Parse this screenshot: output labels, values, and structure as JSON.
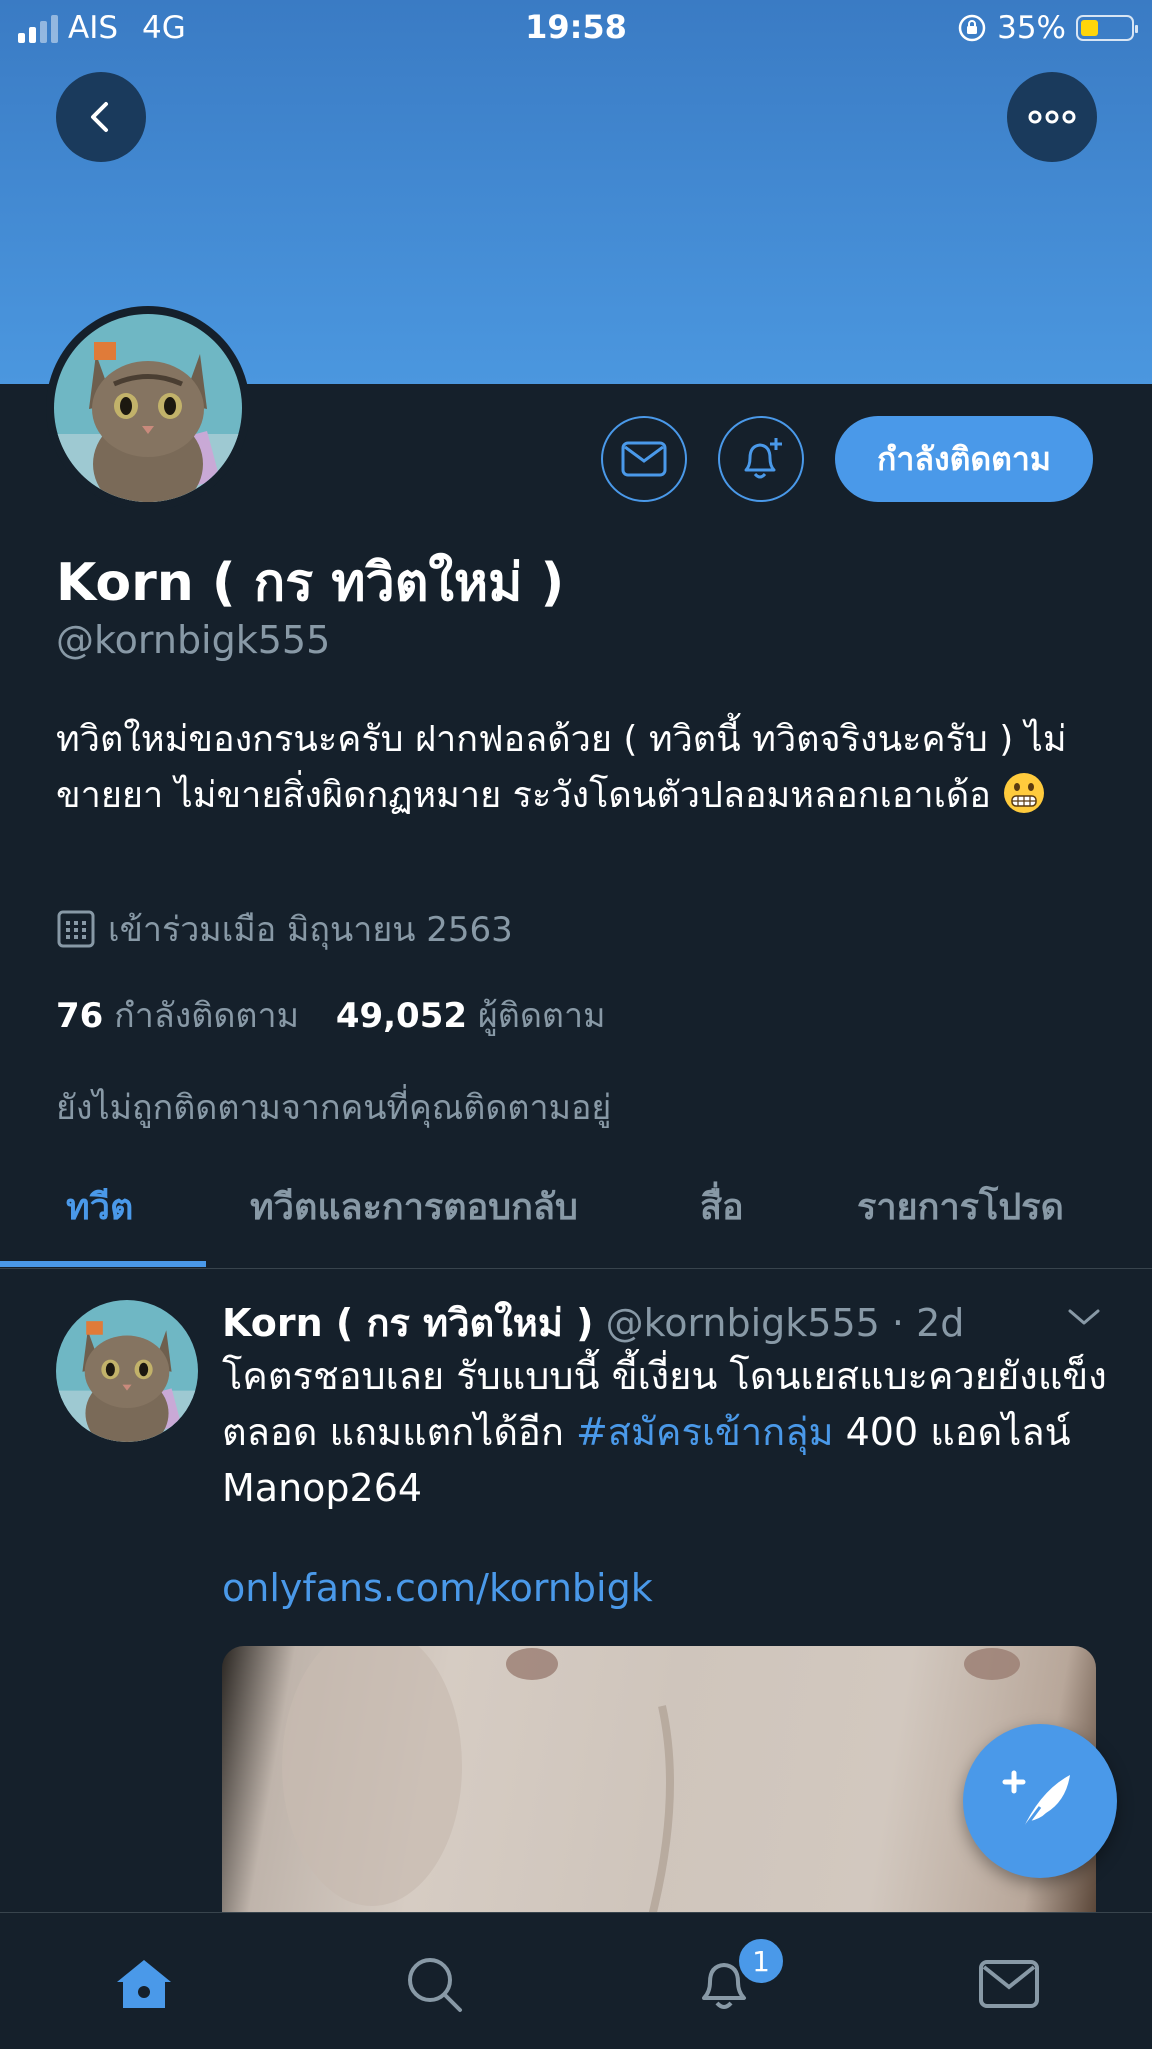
{
  "status_bar": {
    "carrier": "AIS",
    "network": "4G",
    "time": "19:58",
    "battery": "35%",
    "battery_level": 0.35
  },
  "profile": {
    "name": "Korn ( กร ทวิตใหม่ )",
    "handle": "@kornbigk555",
    "follow_button": "กำลังติดตาม",
    "bio": "ทวิตใหม่ของกรนะครับ ฝากฟอลด้วย ( ทวิตนี้ ทวิตจริงนะครับ ) ไม่ขายยา ไม่ขายสิ่งผิดกฏหมาย ระวังโดนตัวปลอมหลอกเอาเด้อ",
    "joined": "เข้าร่วมเมือ มิถุนายน 2563",
    "following_count": "76",
    "following_label": "กำลังติดตาม",
    "followers_count": "49,052",
    "followers_label": "ผู้ติดตาม",
    "not_followed_text": "ยังไม่ถูกติดตามจากคนที่คุณติดตามอยู่"
  },
  "tabs": [
    "ทวีต",
    "ทวีตและการตอบกลับ",
    "สื่อ",
    "รายการโปรด"
  ],
  "active_tab": 0,
  "tweet": {
    "name": "Korn ( กร ทวิตใหม่ )",
    "handle_time": "@kornbigk555 · 2d",
    "text_before": "โคตรชอบเลย รับแบบนี้ ขี้เงี่ยน โดนเยสแบะควยยังแข็งตลอด แถมแตกได้อีก ",
    "hashtag": "#สมัครเข้ากลุ่ม",
    "text_after": " 400 แอดไลน์ Manop264",
    "link": "onlyfans.com/kornbigk"
  },
  "bottom_nav": {
    "items": [
      "home-icon",
      "search-icon",
      "notifications-icon",
      "messages-icon"
    ],
    "notification_badge": "1"
  },
  "colors": {
    "background": "#15202b",
    "accent": "#4a99e9",
    "muted": "#8899a6"
  }
}
